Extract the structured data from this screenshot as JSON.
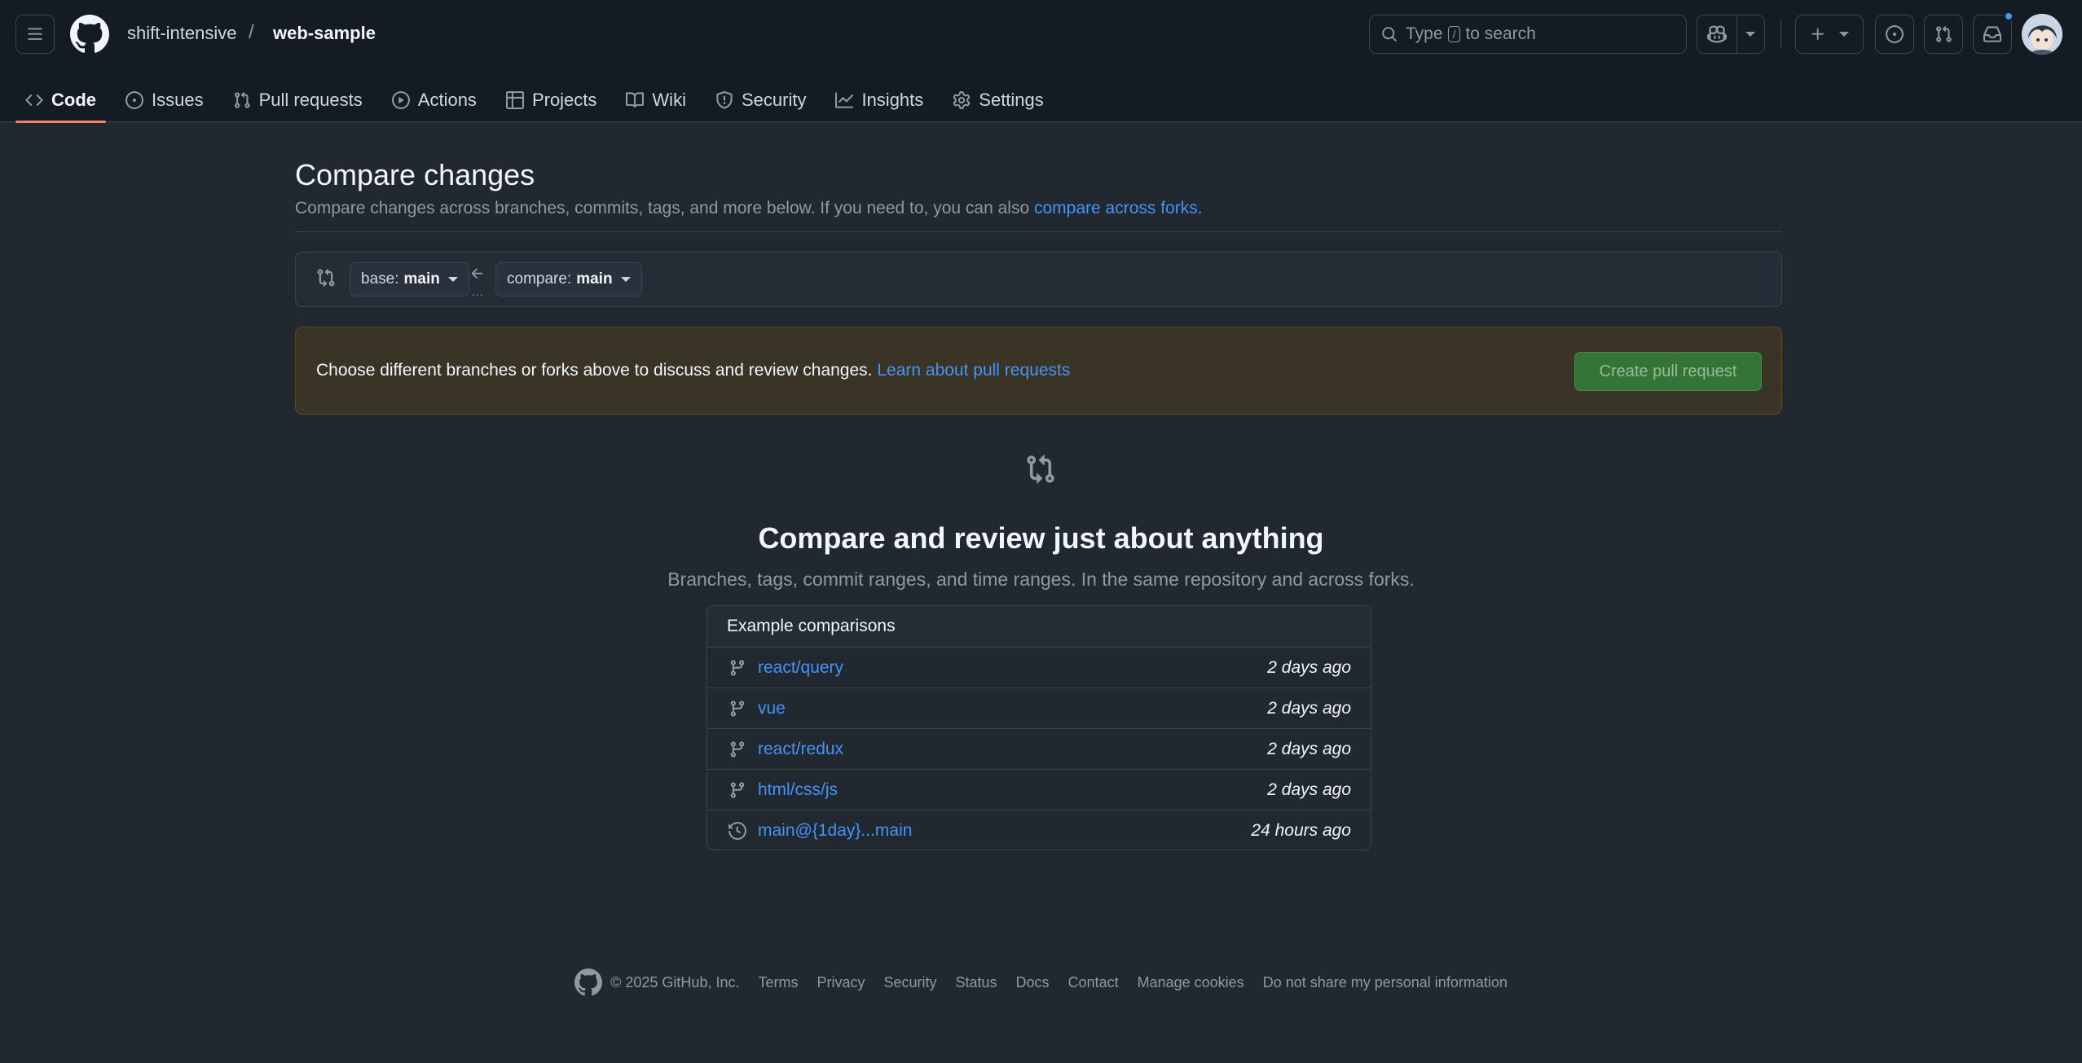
{
  "header": {
    "owner": "shift-intensive",
    "separator": "/",
    "repo": "web-sample",
    "search": {
      "prefix": "Type",
      "key": "/",
      "suffix": "to search"
    }
  },
  "tabs": [
    {
      "label": "Code",
      "icon": "code-icon",
      "active": true
    },
    {
      "label": "Issues",
      "icon": "issue-opened-icon"
    },
    {
      "label": "Pull requests",
      "icon": "git-pull-request-icon"
    },
    {
      "label": "Actions",
      "icon": "play-icon"
    },
    {
      "label": "Projects",
      "icon": "table-icon"
    },
    {
      "label": "Wiki",
      "icon": "book-icon"
    },
    {
      "label": "Security",
      "icon": "shield-icon"
    },
    {
      "label": "Insights",
      "icon": "graph-icon"
    },
    {
      "label": "Settings",
      "icon": "gear-icon"
    }
  ],
  "main": {
    "title": "Compare changes",
    "subtitle": "Compare changes across branches, commits, tags, and more below. If you need to, you can also",
    "subtitle_link": "compare across forks",
    "subtitle_end": ".",
    "base": {
      "prefix": "base:",
      "branch": "main"
    },
    "compare": {
      "prefix": "compare:",
      "branch": "main"
    },
    "range_dots": "...",
    "flash": {
      "text": "Choose different branches or forks above to discuss and review changes.",
      "link": "Learn about pull requests",
      "button": "Create pull request"
    },
    "blank": {
      "title": "Compare and review just about anything",
      "subtitle": "Branches, tags, commit ranges, and time ranges. In the same repository and across forks."
    },
    "examples": {
      "header": "Example comparisons",
      "rows": [
        {
          "label": "react/query",
          "time": "2 days ago",
          "icon": "git-branch-icon"
        },
        {
          "label": "vue",
          "time": "2 days ago",
          "icon": "git-branch-icon"
        },
        {
          "label": "react/redux",
          "time": "2 days ago",
          "icon": "git-branch-icon"
        },
        {
          "label": "html/css/js",
          "time": "2 days ago",
          "icon": "git-branch-icon"
        },
        {
          "label": "main@{1day}...main",
          "time": "24 hours ago",
          "icon": "history-icon"
        }
      ]
    }
  },
  "footer": {
    "copyright": "© 2025 GitHub, Inc.",
    "links": [
      "Terms",
      "Privacy",
      "Security",
      "Status",
      "Docs",
      "Contact",
      "Manage cookies",
      "Do not share my personal information"
    ]
  },
  "colors": {
    "accent": "#4493f8",
    "active_tab": "#f78166",
    "create_button": "#347d39",
    "notification_dot": "#4493f8"
  }
}
